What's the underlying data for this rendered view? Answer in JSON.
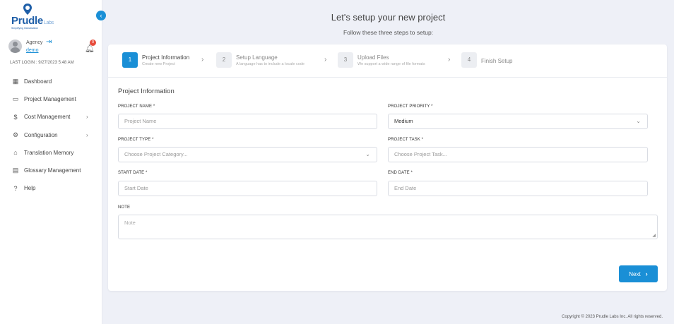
{
  "brand": {
    "name": "Prudle",
    "suffix": "Labs",
    "tagline": "Simplifying Globalization",
    "accent": "#1a8fd6"
  },
  "sidebar": {
    "collapse_icon": "‹",
    "user": {
      "role": "Agency",
      "name": "demo",
      "notifications": "0"
    },
    "last_login": "LAST LOGIN : 9/27/2023 5:48 AM",
    "items": [
      {
        "label": "Dashboard",
        "icon": "▦",
        "chevron": ""
      },
      {
        "label": "Project Management",
        "icon": "▭",
        "chevron": ""
      },
      {
        "label": "Cost Management",
        "icon": "$",
        "chevron": "›"
      },
      {
        "label": "Configuration",
        "icon": "⚙",
        "chevron": "›"
      },
      {
        "label": "Translation Memory",
        "icon": "⌂",
        "chevron": ""
      },
      {
        "label": "Glossary Management",
        "icon": "▤",
        "chevron": ""
      },
      {
        "label": "Help",
        "icon": "?",
        "chevron": ""
      }
    ]
  },
  "header": {
    "title": "Let's setup your new project",
    "subtitle": "Follow these three steps to setup:"
  },
  "steps": [
    {
      "num": "1",
      "title": "Project Information",
      "desc": "Create new Project"
    },
    {
      "num": "2",
      "title": "Setup Language",
      "desc": "A language has to include a locale code"
    },
    {
      "num": "3",
      "title": "Upload Files",
      "desc": "We support a wide range of file formats"
    },
    {
      "num": "4",
      "title": "Finish Setup",
      "desc": ""
    }
  ],
  "form": {
    "title": "Project Information",
    "project_name": {
      "label": "PROJECT NAME *",
      "placeholder": "Project Name"
    },
    "project_priority": {
      "label": "PROJECT PRIORITY *",
      "value": "Medium"
    },
    "project_type": {
      "label": "PROJECT TYPE *",
      "placeholder": "Choose Project Category..."
    },
    "project_task": {
      "label": "PROJECT TASK *",
      "placeholder": "Choose Project Task..."
    },
    "start_date": {
      "label": "START DATE *",
      "placeholder": "Start Date"
    },
    "end_date": {
      "label": "END DATE *",
      "placeholder": "End Date"
    },
    "note": {
      "label": "NOTE",
      "placeholder": "Note"
    },
    "next_label": "Next"
  },
  "footer": {
    "copyright": "Copyright © 2023 Prudle Labs Inc. All rights reserved."
  }
}
